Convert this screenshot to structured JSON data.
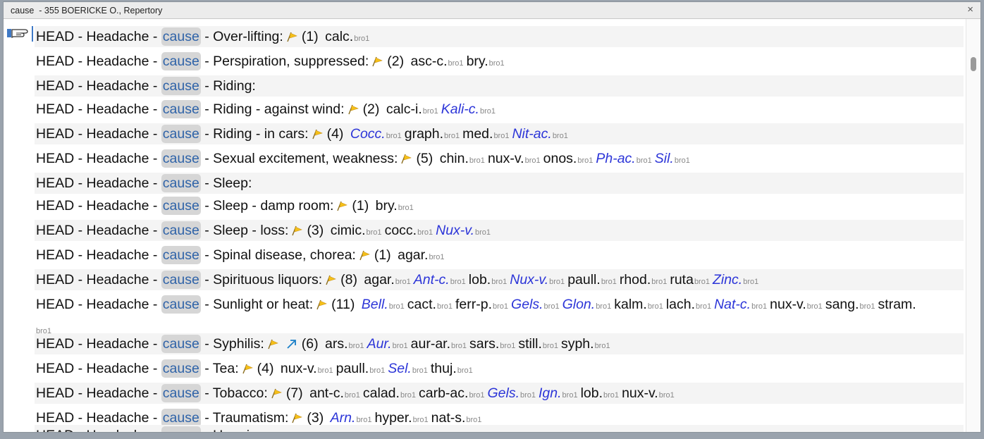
{
  "window": {
    "title": "cause  - 355 BOERICKE O., Repertory",
    "close_label": "×"
  },
  "highlight_color": "#d6d6d6",
  "italic_remedy_color": "#2c35d8",
  "rows": [
    {
      "text": "HEAD - Headache - ",
      "hl": "cause",
      "rest": " - Over-lifting:",
      "flag": true,
      "count": "(1)",
      "remedies": [
        {
          "n": "calc.",
          "s": "bro1",
          "i": false
        }
      ]
    },
    {
      "text": "HEAD - Headache - ",
      "hl": "cause",
      "rest": " - Perspiration, suppressed:",
      "flag": true,
      "count": "(2)",
      "remedies": [
        {
          "n": "asc-c.",
          "s": "bro1",
          "i": false
        },
        {
          "n": "bry.",
          "s": "bro1",
          "i": false
        }
      ]
    },
    {
      "text": "HEAD - Headache - ",
      "hl": "cause",
      "rest": " - Riding:",
      "flag": false,
      "count": "",
      "remedies": []
    },
    {
      "text": "HEAD - Headache - ",
      "hl": "cause",
      "rest": " - Riding - against wind:",
      "flag": true,
      "count": "(2)",
      "remedies": [
        {
          "n": "calc-i.",
          "s": "bro1",
          "i": false
        },
        {
          "n": "Kali-c.",
          "s": "bro1",
          "i": true
        }
      ]
    },
    {
      "text": "HEAD - Headache - ",
      "hl": "cause",
      "rest": " - Riding - in cars:",
      "flag": true,
      "count": "(4)",
      "remedies": [
        {
          "n": "Cocc.",
          "s": "bro1",
          "i": true
        },
        {
          "n": "graph.",
          "s": "bro1",
          "i": false
        },
        {
          "n": "med.",
          "s": "bro1",
          "i": false
        },
        {
          "n": "Nit-ac.",
          "s": "bro1",
          "i": true
        }
      ]
    },
    {
      "text": "HEAD - Headache - ",
      "hl": "cause",
      "rest": " - Sexual excitement, weakness:",
      "flag": true,
      "count": "(5)",
      "remedies": [
        {
          "n": "chin.",
          "s": "bro1",
          "i": false
        },
        {
          "n": "nux-v.",
          "s": "bro1",
          "i": false
        },
        {
          "n": "onos.",
          "s": "bro1",
          "i": false
        },
        {
          "n": "Ph-ac.",
          "s": "bro1",
          "i": true
        },
        {
          "n": "Sil.",
          "s": "bro1",
          "i": true
        }
      ]
    },
    {
      "text": "HEAD - Headache - ",
      "hl": "cause",
      "rest": " - Sleep:",
      "flag": false,
      "count": "",
      "remedies": []
    },
    {
      "text": "HEAD - Headache - ",
      "hl": "cause",
      "rest": " - Sleep - damp room:",
      "flag": true,
      "count": "(1)",
      "remedies": [
        {
          "n": "bry.",
          "s": "bro1",
          "i": false
        }
      ]
    },
    {
      "text": "HEAD - Headache - ",
      "hl": "cause",
      "rest": " - Sleep - loss:",
      "flag": true,
      "count": "(3)",
      "remedies": [
        {
          "n": "cimic.",
          "s": "bro1",
          "i": false
        },
        {
          "n": "cocc.",
          "s": "bro1",
          "i": false
        },
        {
          "n": "Nux-v.",
          "s": "bro1",
          "i": true
        }
      ]
    },
    {
      "text": "HEAD - Headache - ",
      "hl": "cause",
      "rest": " - Spinal disease, chorea:",
      "flag": true,
      "count": "(1)",
      "remedies": [
        {
          "n": "agar.",
          "s": "bro1",
          "i": false
        }
      ]
    },
    {
      "text": "HEAD - Headache - ",
      "hl": "cause",
      "rest": " - Spirituous liquors:",
      "flag": true,
      "count": "(8)",
      "remedies": [
        {
          "n": "agar.",
          "s": "bro1",
          "i": false
        },
        {
          "n": "Ant-c.",
          "s": "bro1",
          "i": true
        },
        {
          "n": "lob.",
          "s": "bro1",
          "i": false
        },
        {
          "n": "Nux-v.",
          "s": "bro1",
          "i": true
        },
        {
          "n": "paull.",
          "s": "bro1",
          "i": false
        },
        {
          "n": "rhod.",
          "s": "bro1",
          "i": false
        },
        {
          "n": "ruta",
          "s": "bro1",
          "i": false
        },
        {
          "n": "Zinc.",
          "s": "bro1",
          "i": true
        }
      ]
    },
    {
      "text": "HEAD - Headache - ",
      "hl": "cause",
      "rest": " - Sunlight or heat:",
      "flag": true,
      "count": "(11)",
      "remedies": [
        {
          "n": "Bell.",
          "s": "bro1",
          "i": true
        },
        {
          "n": "cact.",
          "s": "bro1",
          "i": false
        },
        {
          "n": "ferr-p.",
          "s": "bro1",
          "i": false
        },
        {
          "n": "Gels.",
          "s": "bro1",
          "i": true
        },
        {
          "n": "Glon.",
          "s": "bro1",
          "i": true
        },
        {
          "n": "kalm.",
          "s": "bro1",
          "i": false
        },
        {
          "n": "lach.",
          "s": "bro1",
          "i": false
        },
        {
          "n": "Nat-c.",
          "s": "bro1",
          "i": true
        },
        {
          "n": "nux-v.",
          "s": "bro1",
          "i": false
        },
        {
          "n": "sang.",
          "s": "bro1",
          "i": false
        },
        {
          "n": "stram.",
          "s": "",
          "i": false
        }
      ],
      "wrap_src": "bro1"
    },
    {
      "text": "HEAD - Headache - ",
      "hl": "cause",
      "rest": " - Syphilis:",
      "flag": true,
      "arrow": true,
      "count": "(6)",
      "remedies": [
        {
          "n": "ars.",
          "s": "bro1",
          "i": false
        },
        {
          "n": "Aur.",
          "s": "bro1",
          "i": true
        },
        {
          "n": "aur-ar.",
          "s": "bro1",
          "i": false
        },
        {
          "n": "sars.",
          "s": "bro1",
          "i": false
        },
        {
          "n": "still.",
          "s": "bro1",
          "i": false
        },
        {
          "n": "syph.",
          "s": "bro1",
          "i": false
        }
      ]
    },
    {
      "text": "HEAD - Headache - ",
      "hl": "cause",
      "rest": " - Tea:",
      "flag": true,
      "count": "(4)",
      "remedies": [
        {
          "n": "nux-v.",
          "s": "bro1",
          "i": false
        },
        {
          "n": "paull.",
          "s": "bro1",
          "i": false
        },
        {
          "n": "Sel.",
          "s": "bro1",
          "i": true
        },
        {
          "n": "thuj.",
          "s": "bro1",
          "i": false
        }
      ]
    },
    {
      "text": "HEAD - Headache - ",
      "hl": "cause",
      "rest": " - Tobacco:",
      "flag": true,
      "count": "(7)",
      "remedies": [
        {
          "n": "ant-c.",
          "s": "bro1",
          "i": false
        },
        {
          "n": "calad.",
          "s": "bro1",
          "i": false
        },
        {
          "n": "carb-ac.",
          "s": "bro1",
          "i": false
        },
        {
          "n": "Gels.",
          "s": "bro1",
          "i": true
        },
        {
          "n": "Ign.",
          "s": "bro1",
          "i": true
        },
        {
          "n": "lob.",
          "s": "bro1",
          "i": false
        },
        {
          "n": "nux-v.",
          "s": "bro1",
          "i": false
        }
      ]
    },
    {
      "text": "HEAD - Headache - ",
      "hl": "cause",
      "rest": " - Traumatism:",
      "flag": true,
      "count": "(3)",
      "remedies": [
        {
          "n": "Arn.",
          "s": "bro1",
          "i": true
        },
        {
          "n": "hyper.",
          "s": "bro1",
          "i": false
        },
        {
          "n": "nat-s.",
          "s": "bro1",
          "i": false
        }
      ]
    },
    {
      "text": "HEAD - Headache - ",
      "hl": "cause",
      "rest": " - Uremic",
      "flag": false,
      "count": "",
      "remedies": []
    }
  ]
}
